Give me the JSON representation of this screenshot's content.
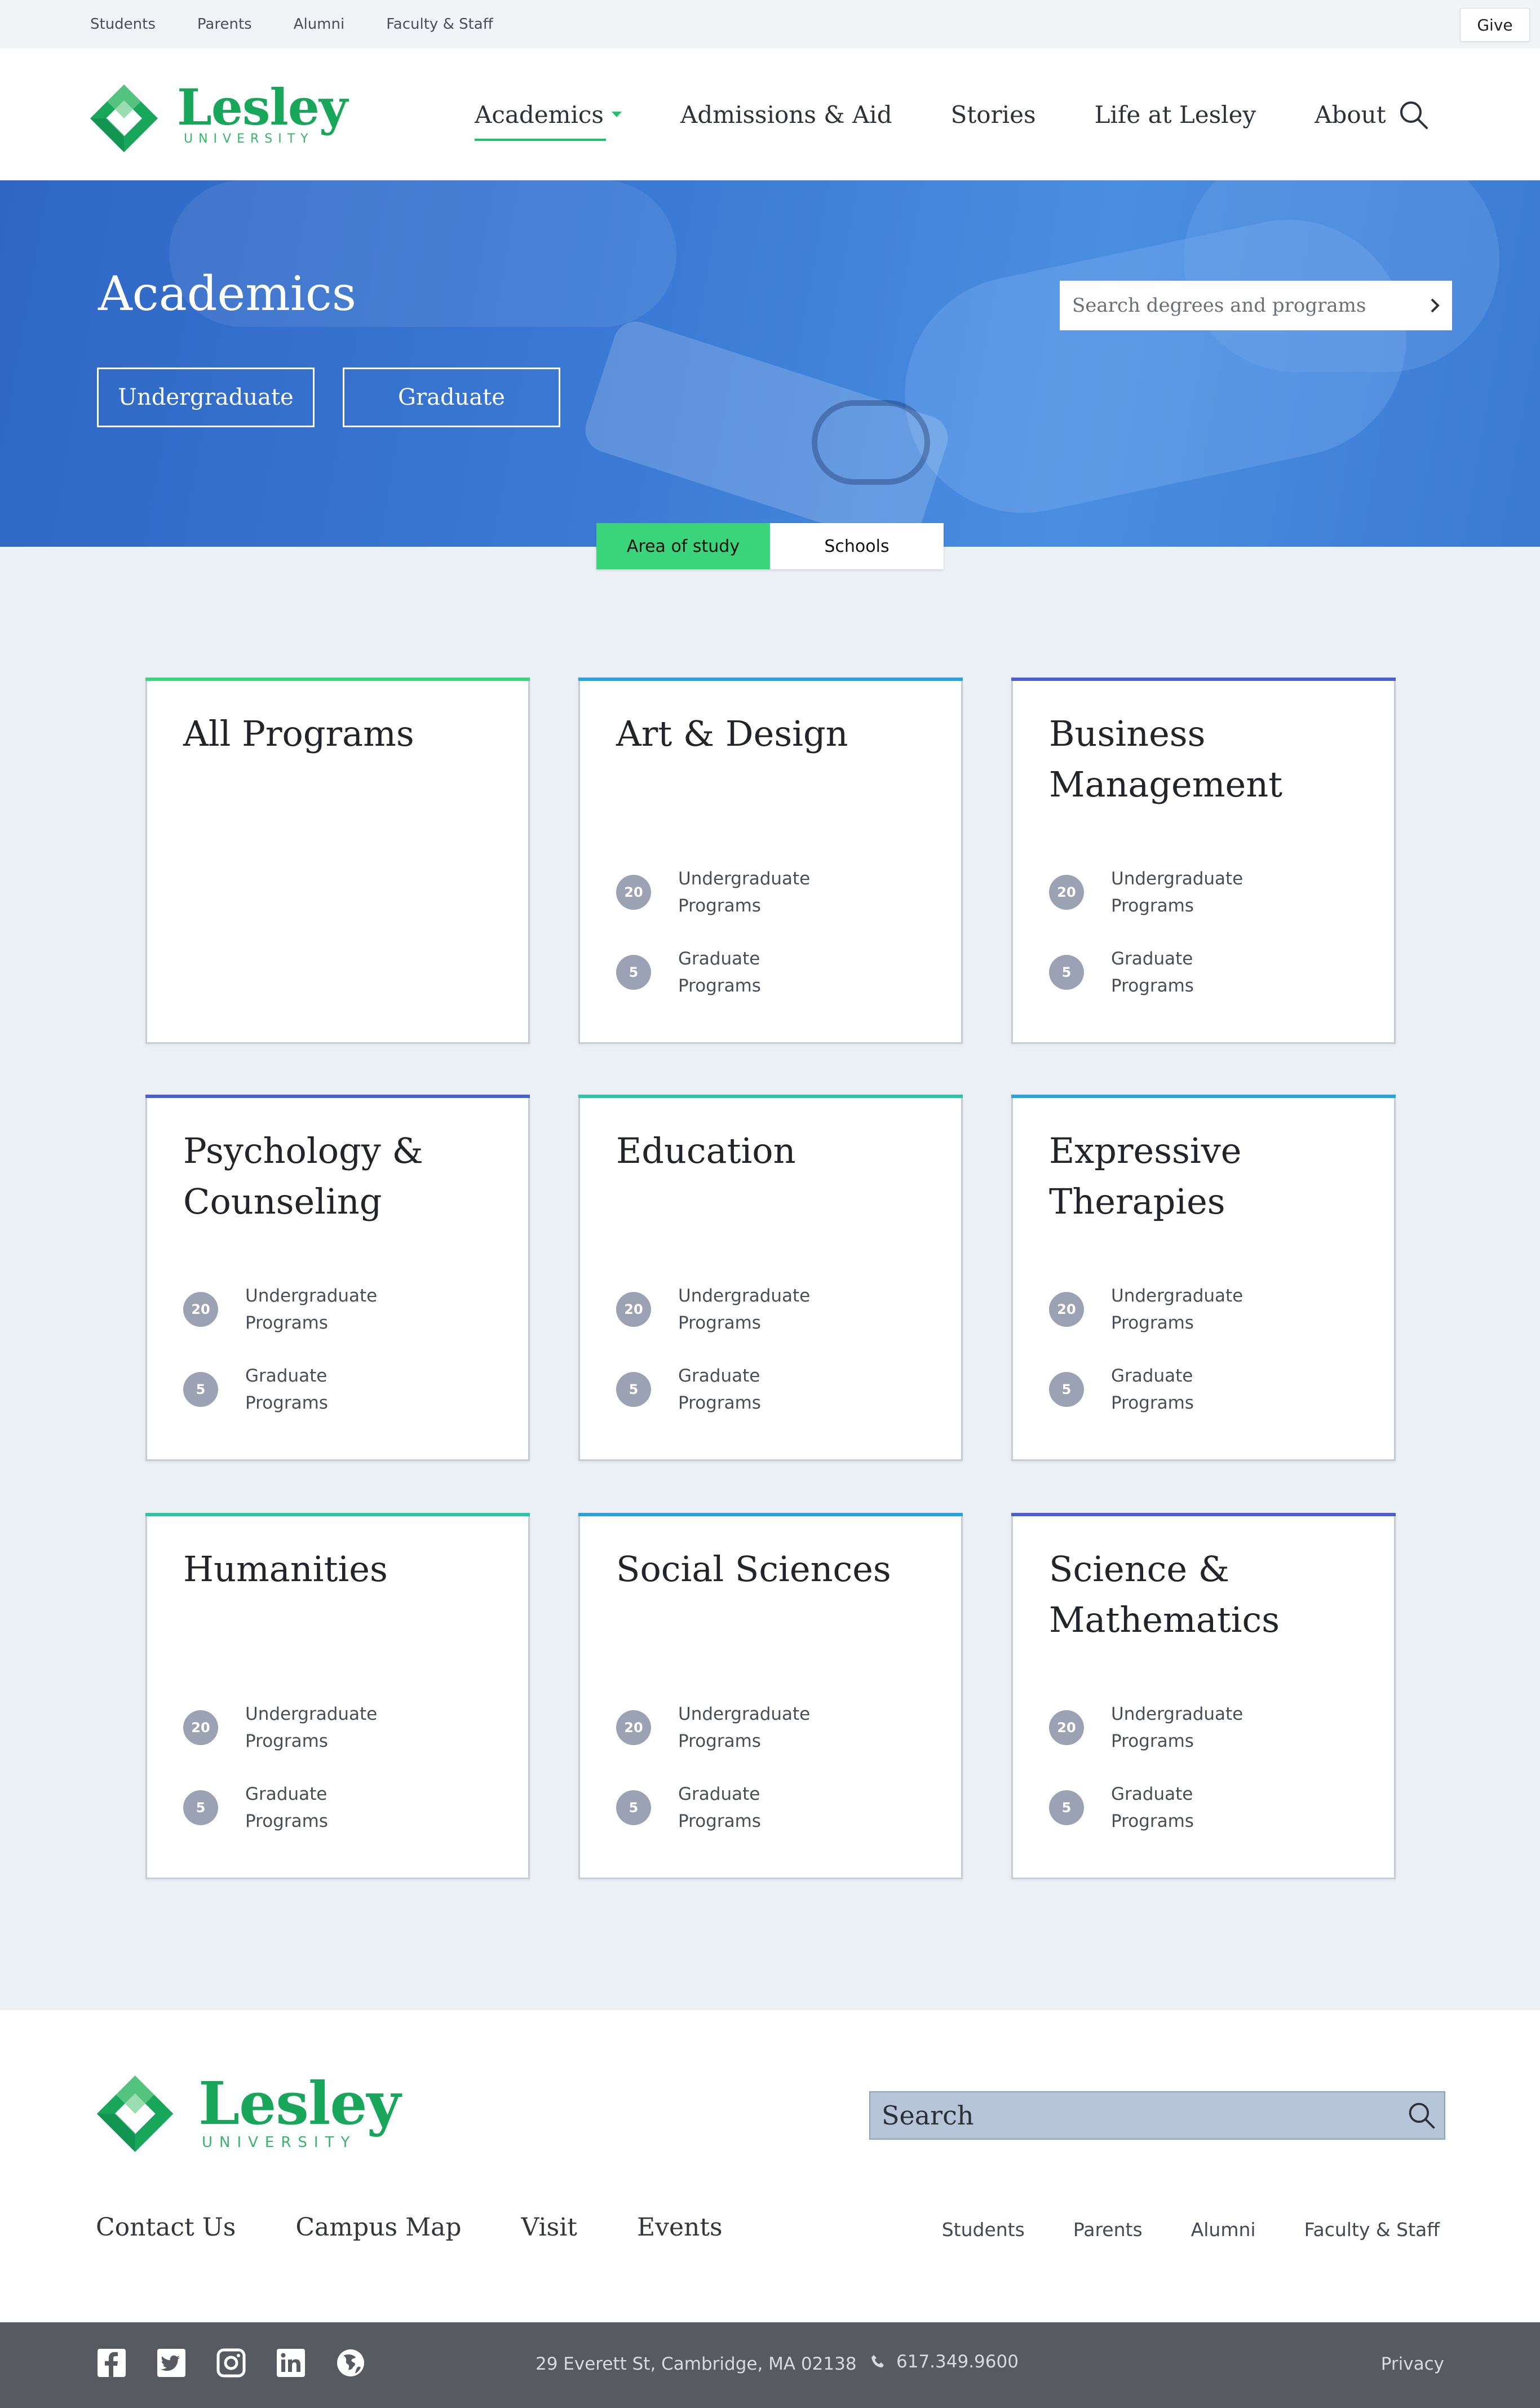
{
  "utility": {
    "links": [
      "Students",
      "Parents",
      "Alumni",
      "Faculty & Staff"
    ],
    "give": "Give"
  },
  "brand": {
    "name": "Lesley",
    "sub": "UNIVERSITY",
    "color": "#17a65a",
    "accent": "#1fc36a"
  },
  "nav": {
    "items": [
      "Academics",
      "Admissions & Aid",
      "Stories",
      "Life at Lesley",
      "About"
    ],
    "active": "Academics",
    "search_icon": "search-icon"
  },
  "hero": {
    "title": "Academics",
    "buttons": [
      "Undergraduate",
      "Graduate"
    ],
    "search_placeholder": "Search degrees and programs"
  },
  "toggle": {
    "options": [
      "Area of study",
      "Schools"
    ],
    "selected": "Area of study"
  },
  "cards": [
    {
      "title": "All Programs",
      "accent": "#3ad57a",
      "show_counts": false
    },
    {
      "title": "Art & Design",
      "accent": "#29a3e0",
      "show_counts": true,
      "ug_count": "20",
      "ug_label": "Undergraduate Programs",
      "gr_count": "5",
      "gr_label": "Graduate Programs"
    },
    {
      "title": "Business Management",
      "accent": "#4a5fd0",
      "show_counts": true,
      "ug_count": "20",
      "ug_label": "Undergraduate Programs",
      "gr_count": "5",
      "gr_label": "Graduate Programs"
    },
    {
      "title": "Psychology & Counseling",
      "accent": "#4a5fd0",
      "show_counts": true,
      "ug_count": "20",
      "ug_label": "Undergraduate Programs",
      "gr_count": "5",
      "gr_label": "Graduate Programs"
    },
    {
      "title": "Education",
      "accent": "#2cc6a4",
      "show_counts": true,
      "ug_count": "20",
      "ug_label": "Undergraduate Programs",
      "gr_count": "5",
      "gr_label": "Graduate Programs"
    },
    {
      "title": "Expressive Therapies",
      "accent": "#29a3e0",
      "show_counts": true,
      "ug_count": "20",
      "ug_label": "Undergraduate Programs",
      "gr_count": "5",
      "gr_label": "Graduate Programs"
    },
    {
      "title": "Humanities",
      "accent": "#2cc6a4",
      "show_counts": true,
      "ug_count": "20",
      "ug_label": "Undergraduate Programs",
      "gr_count": "5",
      "gr_label": "Graduate Programs"
    },
    {
      "title": "Social Sciences",
      "accent": "#29a3e0",
      "show_counts": true,
      "ug_count": "20",
      "ug_label": "Undergraduate Programs",
      "gr_count": "5",
      "gr_label": "Graduate Programs"
    },
    {
      "title": "Science & Mathematics",
      "accent": "#4a5fd0",
      "show_counts": true,
      "ug_count": "20",
      "ug_label": "Undergraduate Programs",
      "gr_count": "5",
      "gr_label": "Graduate Programs"
    }
  ],
  "footer": {
    "search_placeholder": "Search",
    "links": [
      "Contact Us",
      "Campus Map",
      "Visit",
      "Events"
    ],
    "audience_links": [
      "Students",
      "Parents",
      "Alumni",
      "Faculty & Staff"
    ],
    "social": [
      "facebook-icon",
      "twitter-icon",
      "instagram-icon",
      "linkedin-icon",
      "globe-icon"
    ],
    "address": "29 Everett St, Cambridge, MA 02138",
    "phone": "617.349.9600",
    "privacy": "Privacy"
  }
}
